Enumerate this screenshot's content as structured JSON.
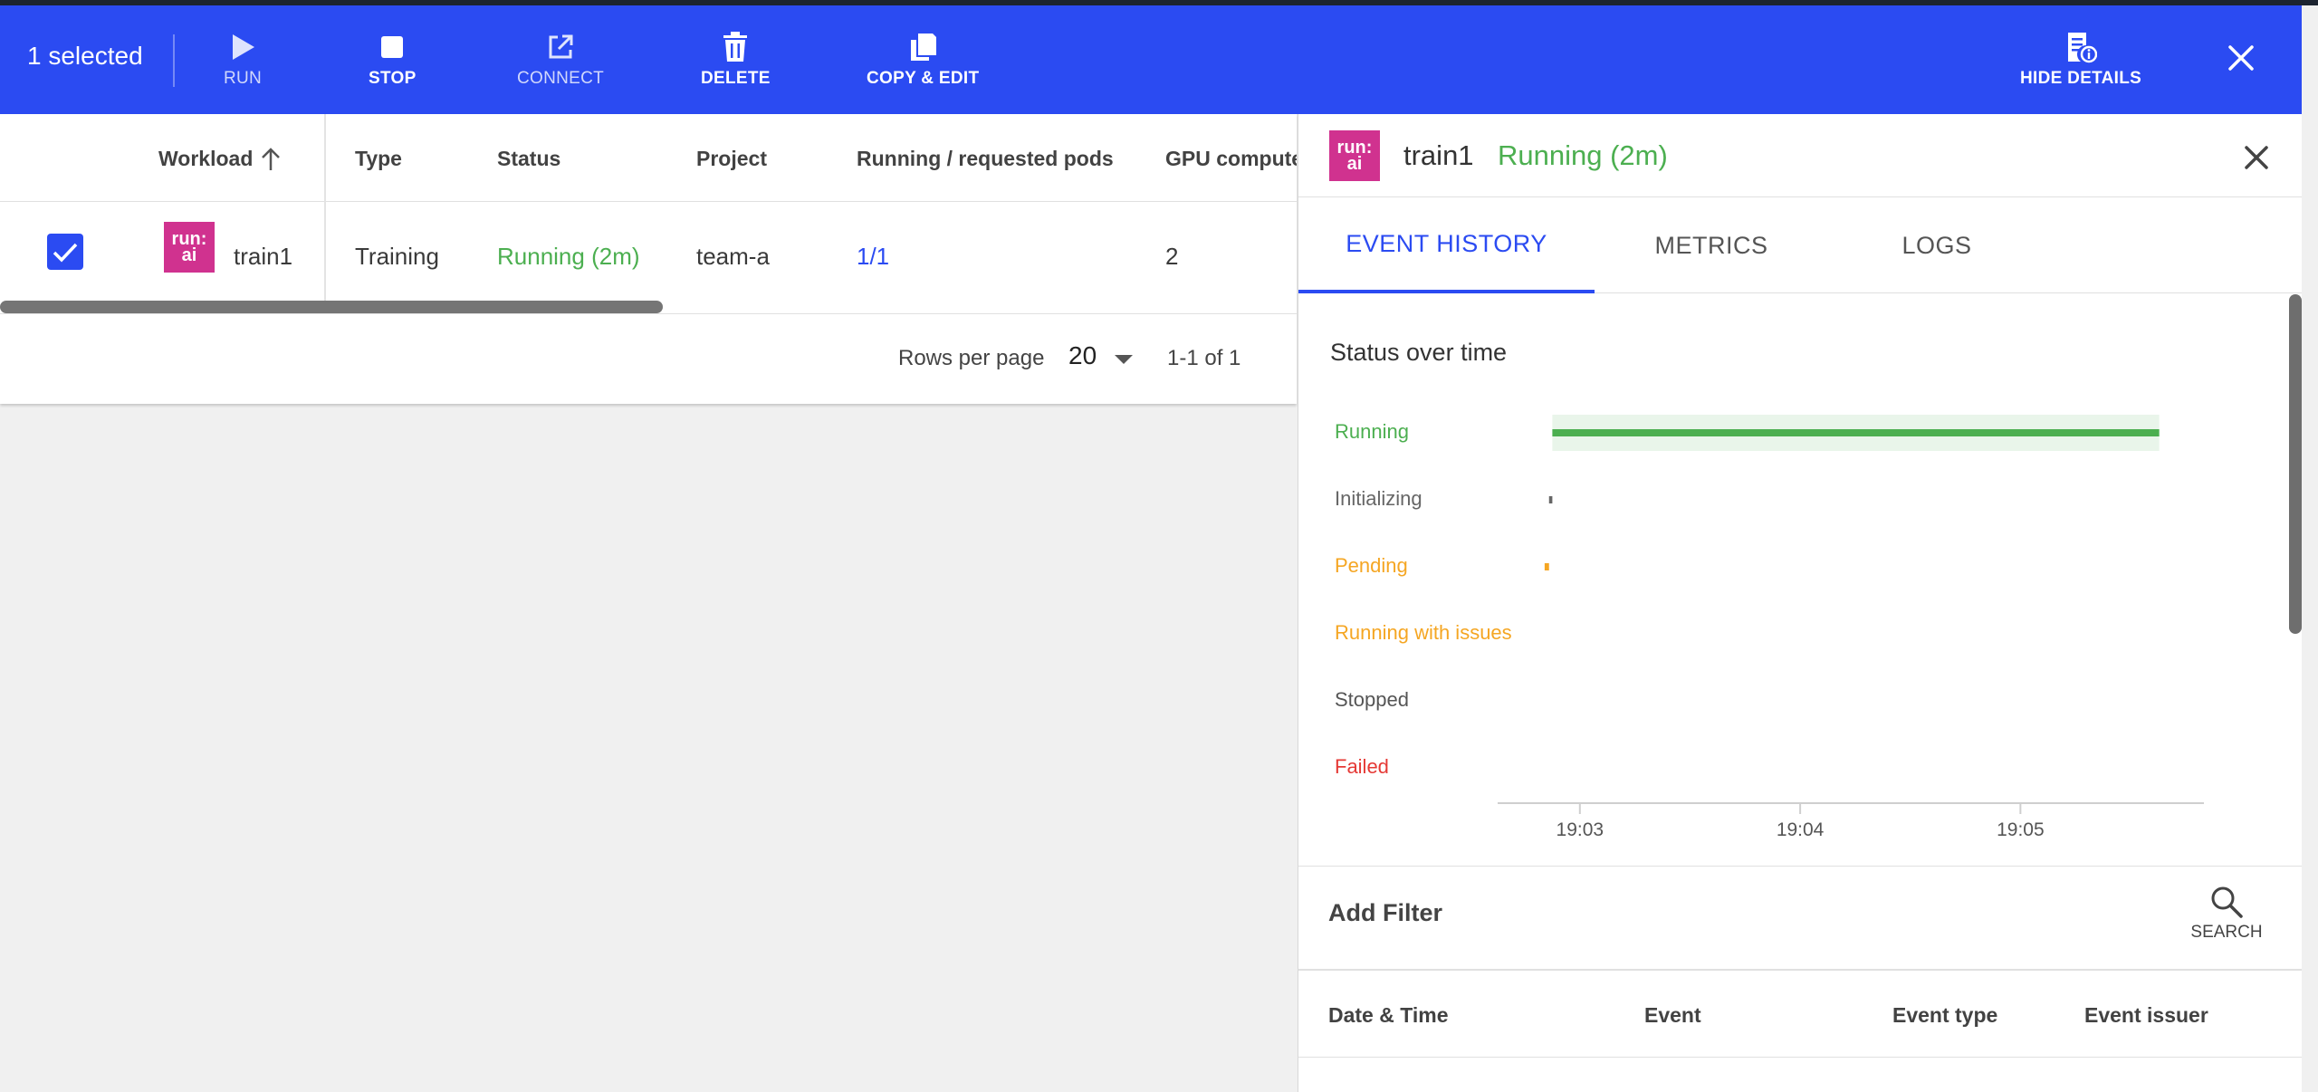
{
  "actionbar": {
    "selected_text": "1 selected",
    "buttons": [
      {
        "label": "RUN",
        "icon": "play-icon",
        "enabled": false
      },
      {
        "label": "STOP",
        "icon": "stop-icon",
        "enabled": true
      },
      {
        "label": "CONNECT",
        "icon": "external-link-icon",
        "enabled": false
      },
      {
        "label": "DELETE",
        "icon": "trash-icon",
        "enabled": true
      },
      {
        "label": "COPY & EDIT",
        "icon": "copy-icon",
        "enabled": true
      },
      {
        "label": "HIDE DETAILS",
        "icon": "details-icon",
        "enabled": true
      }
    ],
    "close_icon": "close-icon",
    "color": "#2b4bf2"
  },
  "table": {
    "columns": [
      "Workload",
      "Type",
      "Status",
      "Project",
      "Running / requested pods",
      "GPU compute"
    ],
    "sort_icon": "arrow-up-icon",
    "rows": [
      {
        "checked": true,
        "logo_line1": "run:",
        "logo_line2": "ai",
        "workload": "train1",
        "type": "Training",
        "status": "Running (2m)",
        "project": "team-a",
        "pods": "1/1",
        "gpu": "2"
      }
    ],
    "pagination": {
      "rows_per_page_label": "Rows per page",
      "rows_per_page": "20",
      "range": "1-1 of 1"
    }
  },
  "details": {
    "name": "train1",
    "status": "Running (2m)",
    "logo_line1": "run:",
    "logo_line2": "ai",
    "tabs": [
      "EVENT HISTORY",
      "METRICS",
      "LOGS"
    ],
    "active_tab": "EVENT HISTORY",
    "chart_title": "Status over time",
    "filter_label": "Add Filter",
    "search_label": "SEARCH",
    "event_columns": [
      "Date & Time",
      "Event",
      "Event type",
      "Event issuer"
    ]
  },
  "chart_data": {
    "type": "timeline",
    "title": "Status over time",
    "states": [
      {
        "name": "Running",
        "color": "#4caf50"
      },
      {
        "name": "Initializing",
        "color": "#666666"
      },
      {
        "name": "Pending",
        "color": "#f5a623"
      },
      {
        "name": "Running with issues",
        "color": "#f5a623"
      },
      {
        "name": "Stopped",
        "color": "#555555"
      },
      {
        "name": "Failed",
        "color": "#e53935"
      }
    ],
    "x_ticks": [
      "19:03",
      "19:04",
      "19:05"
    ],
    "x_range_minutes": [
      2.75,
      5.8
    ],
    "segments": [
      {
        "state": "Pending",
        "start": 2.84,
        "end": 2.86
      },
      {
        "state": "Initializing",
        "start": 2.86,
        "end": 2.875
      },
      {
        "state": "Running",
        "start": 2.875,
        "end": 5.63
      }
    ]
  },
  "colors": {
    "accent": "#2b4bf2",
    "running": "#4caf50",
    "pending": "#f5a623",
    "failed": "#e53935",
    "logo": "#d0328f"
  }
}
